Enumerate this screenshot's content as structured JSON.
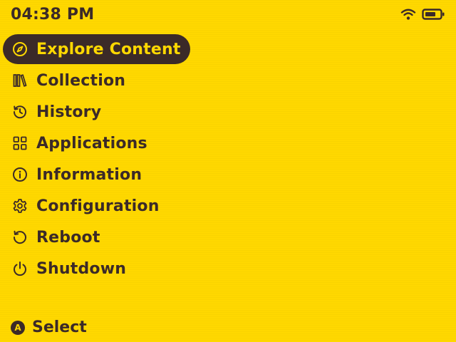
{
  "status_bar": {
    "time": "04:38 PM",
    "wifi_icon": "wifi-icon",
    "battery_icon": "battery-icon"
  },
  "menu": {
    "items": [
      {
        "label": "Explore Content",
        "icon": "compass-icon",
        "selected": true
      },
      {
        "label": "Collection",
        "icon": "books-icon",
        "selected": false
      },
      {
        "label": "History",
        "icon": "history-icon",
        "selected": false
      },
      {
        "label": "Applications",
        "icon": "grid-icon",
        "selected": false
      },
      {
        "label": "Information",
        "icon": "info-icon",
        "selected": false
      },
      {
        "label": "Configuration",
        "icon": "gear-icon",
        "selected": false
      },
      {
        "label": "Reboot",
        "icon": "reboot-icon",
        "selected": false
      },
      {
        "label": "Shutdown",
        "icon": "power-icon",
        "selected": false
      }
    ]
  },
  "footer": {
    "button_glyph": "A",
    "select_label": "Select"
  },
  "colors": {
    "background": "#FFD800",
    "foreground": "#3B2A28",
    "selected_bg": "#3B2A28",
    "selected_fg": "#FFD800"
  }
}
